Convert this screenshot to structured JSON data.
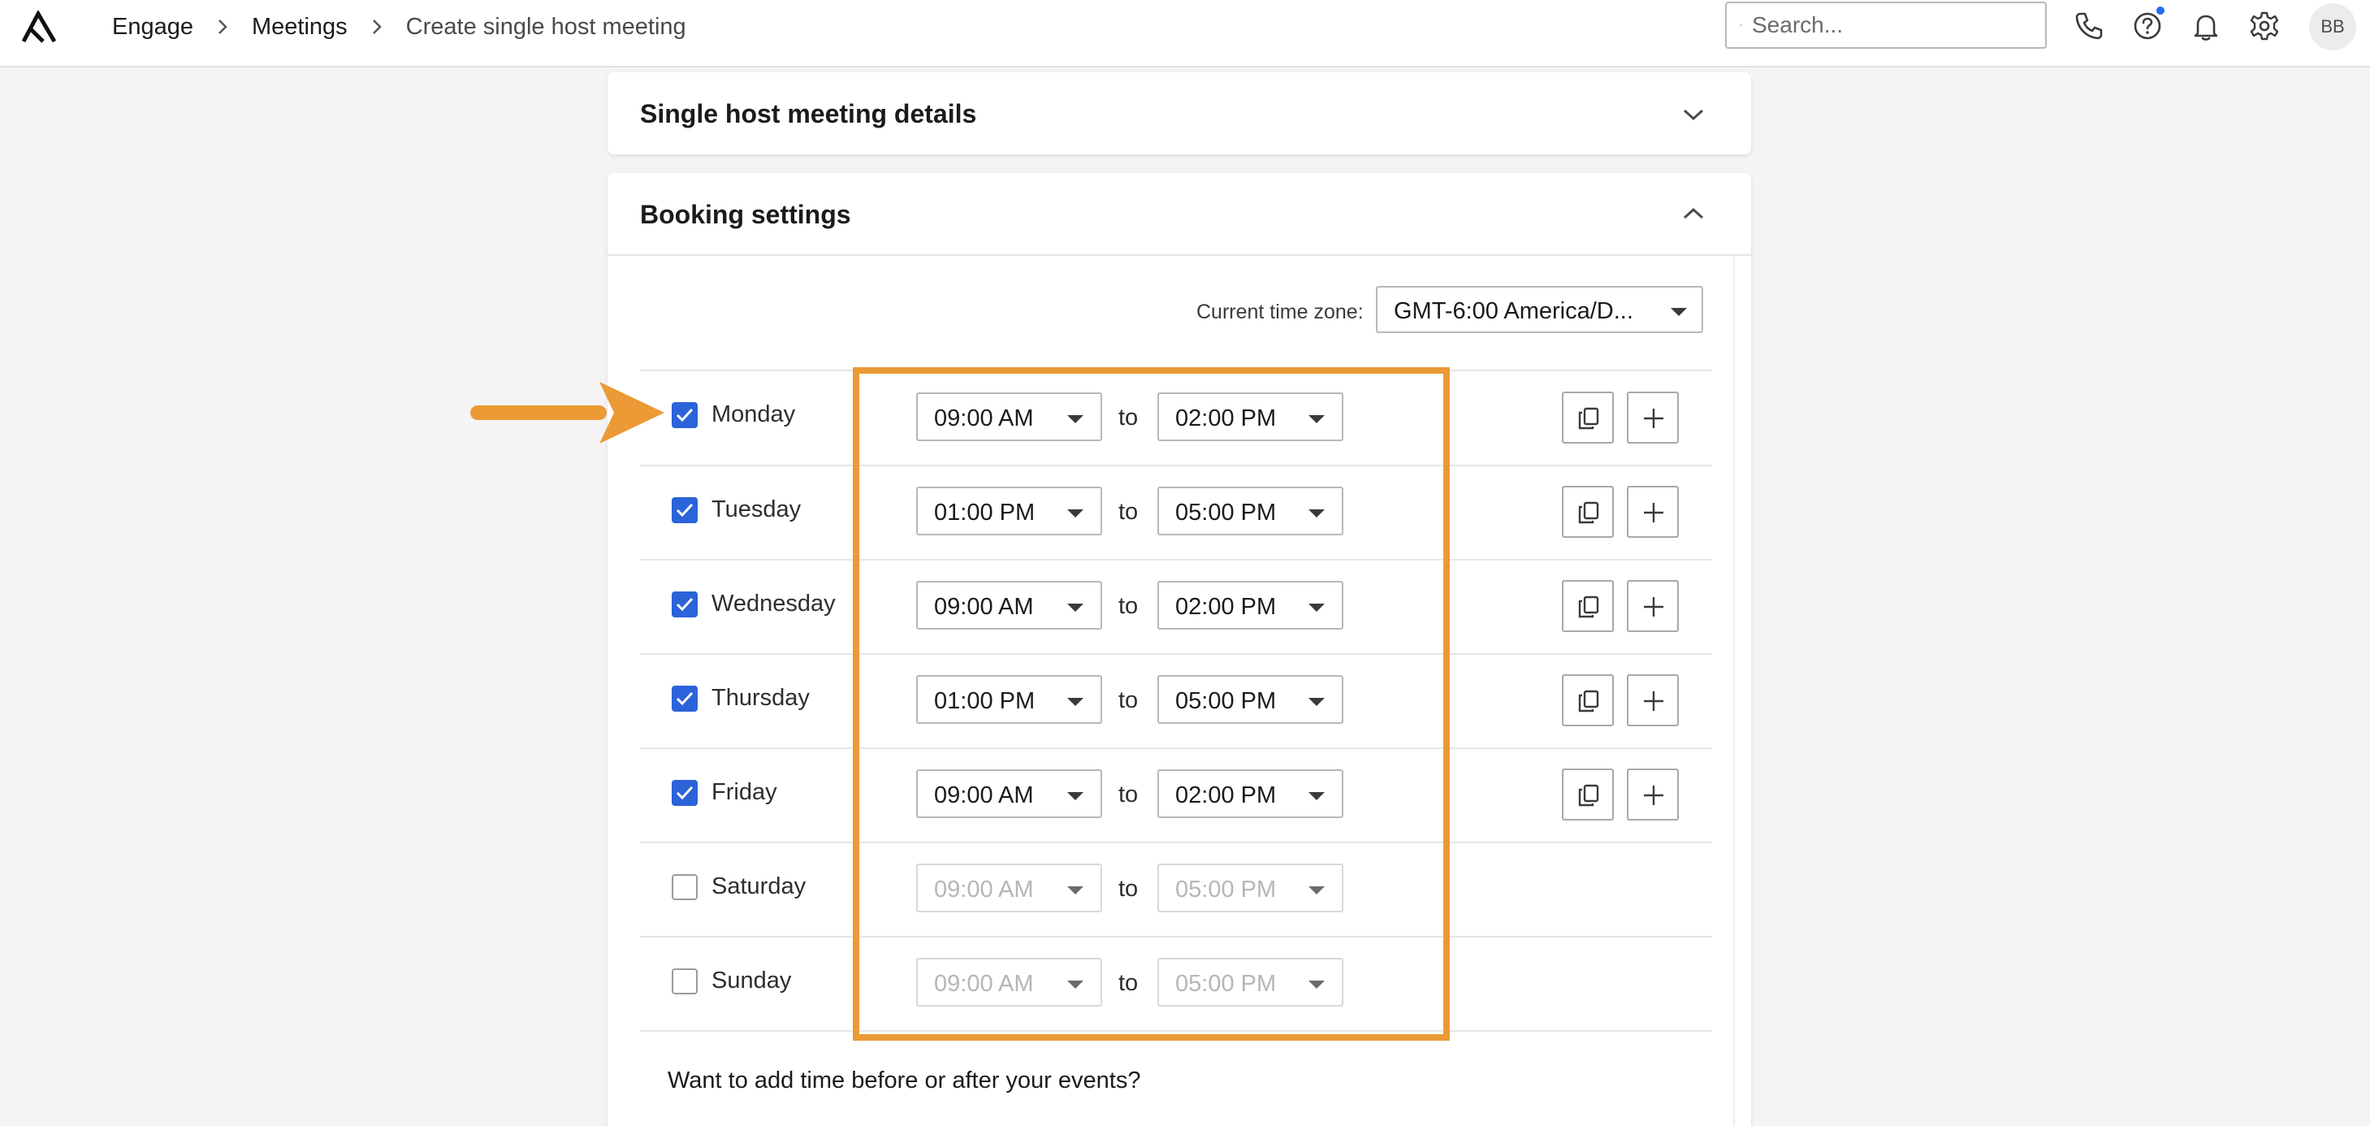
{
  "breadcrumb": {
    "items": [
      "Engage",
      "Meetings",
      "Create single host meeting"
    ]
  },
  "search": {
    "placeholder": "Search..."
  },
  "user": {
    "initials": "BB"
  },
  "colors": {
    "accent": "#2b63d9",
    "highlight": "#eb9a35",
    "notification_dot": "#1f6cf3"
  },
  "icons": {
    "logo": "logo-icon",
    "search": "search-icon",
    "phone": "phone-icon",
    "help": "help-icon",
    "notifications": "bell-icon",
    "settings": "gear-icon",
    "copy": "copy-icon",
    "add": "plus-icon",
    "collapse": "chevron-icon"
  },
  "details_section": {
    "title": "Single host meeting details"
  },
  "booking_section": {
    "title": "Booking settings",
    "timezone_label": "Current time zone:",
    "timezone_value": "GMT-6:00 America/D...",
    "to_label": "to",
    "buffer_question": "Want to add time before or after your events?",
    "days": [
      {
        "name": "Monday",
        "checked": true,
        "start": "09:00 AM",
        "end": "02:00 PM"
      },
      {
        "name": "Tuesday",
        "checked": true,
        "start": "01:00 PM",
        "end": "05:00 PM"
      },
      {
        "name": "Wednesday",
        "checked": true,
        "start": "09:00 AM",
        "end": "02:00 PM"
      },
      {
        "name": "Thursday",
        "checked": true,
        "start": "01:00 PM",
        "end": "05:00 PM"
      },
      {
        "name": "Friday",
        "checked": true,
        "start": "09:00 AM",
        "end": "02:00 PM"
      },
      {
        "name": "Saturday",
        "checked": false,
        "start": "09:00 AM",
        "end": "05:00 PM"
      },
      {
        "name": "Sunday",
        "checked": false,
        "start": "09:00 AM",
        "end": "05:00 PM"
      }
    ]
  }
}
